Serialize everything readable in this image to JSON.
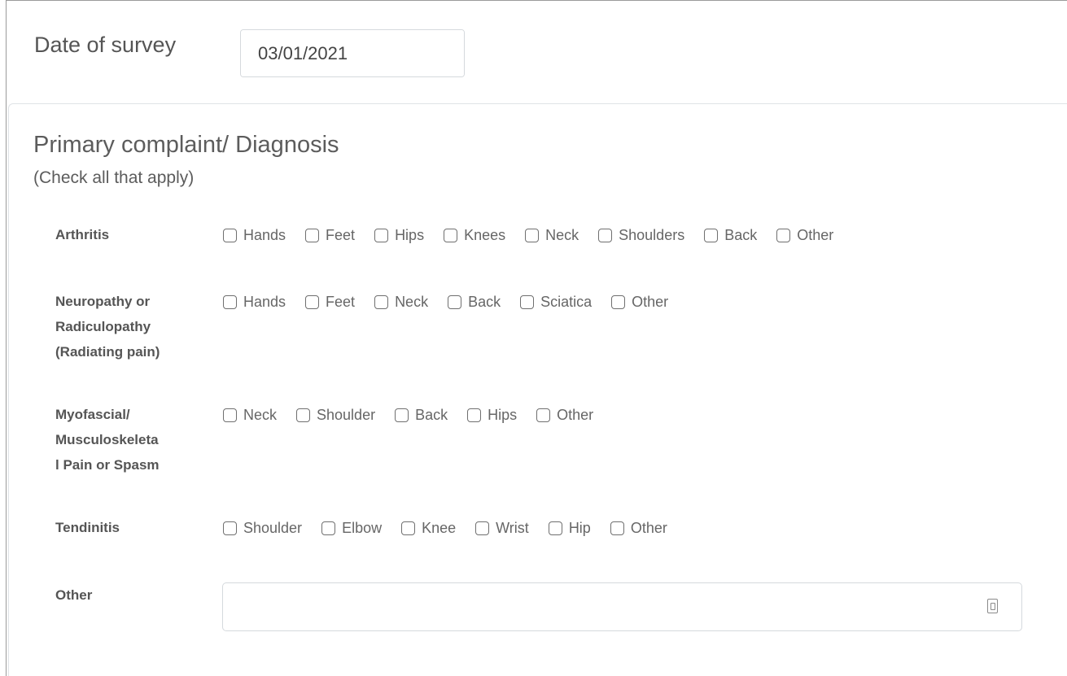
{
  "survey": {
    "date_label": "Date of survey",
    "date_value": "03/01/2021"
  },
  "section": {
    "title": "Primary complaint/ Diagnosis",
    "hint": "(Check all that apply)"
  },
  "rows": {
    "arthritis": {
      "label_lines": [
        "Arthritis"
      ],
      "options": [
        "Hands",
        "Feet",
        "Hips",
        "Knees",
        "Neck",
        "Shoulders",
        "Back",
        "Other"
      ]
    },
    "neuropathy": {
      "label_lines": [
        "Neuropathy or",
        "Radiculopathy",
        "(Radiating pain)"
      ],
      "options": [
        "Hands",
        "Feet",
        "Neck",
        "Back",
        "Sciatica",
        "Other"
      ]
    },
    "myofascial": {
      "label_lines": [
        "Myofascial/",
        "Musculoskeleta",
        "l Pain or Spasm"
      ],
      "options": [
        "Neck",
        "Shoulder",
        "Back",
        "Hips",
        "Other"
      ]
    },
    "tendinitis": {
      "label_lines": [
        "Tendinitis"
      ],
      "options": [
        "Shoulder",
        "Elbow",
        "Knee",
        "Wrist",
        "Hip",
        "Other"
      ]
    }
  },
  "other": {
    "label": "Other",
    "value": "",
    "icon": "contact-card-icon"
  },
  "colors": {
    "text": "#555555",
    "input_border": "#d5d9dd",
    "addon_bg": "#e9ecef",
    "checkbox_border": "#6f6f6f"
  }
}
